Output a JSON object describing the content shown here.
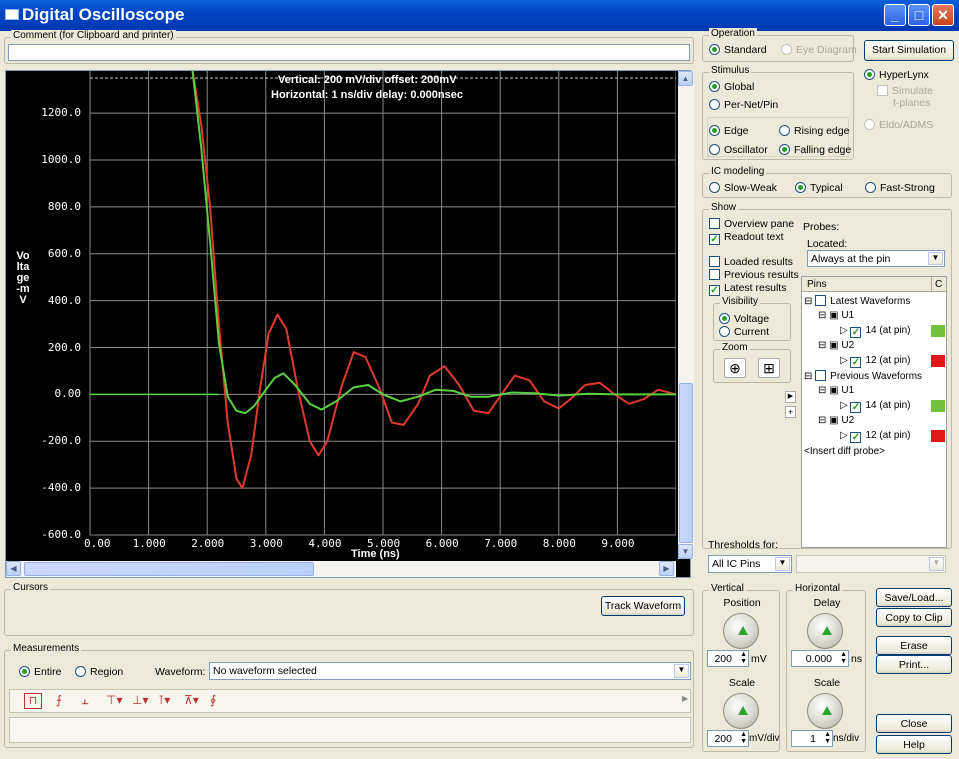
{
  "window": {
    "title": "Digital Oscilloscope"
  },
  "comment": {
    "label": "Comment (for Clipboard and printer)",
    "value": ""
  },
  "plot": {
    "header_vertical": "Vertical: 200 mV/div  offset: 200mV",
    "header_horizontal": "Horizontal: 1 ns/div  delay: 0.000nsec",
    "ylabel": "Voltage-mV",
    "xlabel": "Time  (ns)",
    "yticks": [
      "1200.0",
      "1000.0",
      "800.0",
      "600.0",
      "400.0",
      "200.0",
      "0.00",
      "-200.0",
      "-400.0",
      "-600.0"
    ],
    "xticks": [
      "0.00",
      "1.000",
      "2.000",
      "3.000",
      "4.000",
      "5.000",
      "6.000",
      "7.000",
      "8.000",
      "9.000"
    ]
  },
  "chart_data": {
    "type": "line",
    "xlabel": "Time  (ns)",
    "ylabel": "Voltage-mV",
    "xlim": [
      0,
      10
    ],
    "ylim": [
      -600,
      1380
    ],
    "grid": true,
    "series": [
      {
        "color": "#e03a2e",
        "x": [
          1.75,
          1.9,
          2.05,
          2.2,
          2.35,
          2.5,
          2.6,
          2.75,
          2.9,
          3.05,
          3.2,
          3.35,
          3.55,
          3.75,
          3.9,
          4.05,
          4.3,
          4.5,
          4.7,
          4.95,
          5.15,
          5.35,
          5.6,
          5.8,
          6.05,
          6.3,
          6.55,
          6.8,
          7.05,
          7.25,
          7.5,
          7.75,
          8.0,
          8.2,
          8.45,
          8.7,
          8.95,
          9.2,
          9.45,
          9.7,
          10.0
        ],
        "y": [
          1380,
          1150,
          800,
          300,
          -120,
          -360,
          -400,
          -260,
          20,
          260,
          340,
          280,
          20,
          -200,
          -260,
          -200,
          40,
          180,
          160,
          20,
          -120,
          -130,
          -40,
          80,
          120,
          40,
          -70,
          -80,
          10,
          80,
          60,
          -30,
          -60,
          -20,
          40,
          50,
          0,
          -40,
          -20,
          20,
          0
        ]
      },
      {
        "color": "#58d040",
        "x": [
          1.75,
          1.9,
          2.05,
          2.2,
          2.35,
          2.5,
          2.65,
          2.8,
          3.0,
          3.15,
          3.3,
          3.5,
          3.75,
          3.95,
          4.2,
          4.5,
          4.75,
          5.0,
          5.3,
          5.6,
          5.9,
          6.2,
          6.5,
          6.8,
          7.2,
          7.6,
          8.0,
          8.5,
          9.0,
          10.0
        ],
        "y": [
          1380,
          1050,
          650,
          220,
          -10,
          -70,
          -80,
          -50,
          20,
          70,
          90,
          40,
          -40,
          -65,
          -30,
          30,
          40,
          0,
          -30,
          -10,
          20,
          15,
          -10,
          -10,
          8,
          5,
          -5,
          3,
          0,
          0
        ]
      }
    ]
  },
  "operation": {
    "label": "Operation",
    "standard": "Standard",
    "eye": "Eye Diagram",
    "start": "Start Simulation"
  },
  "stimulus": {
    "label": "Stimulus",
    "global": "Global",
    "pernet": "Per-Net/Pin",
    "edge": "Edge",
    "oscillator": "Oscillator",
    "rising": "Rising edge",
    "falling": "Falling edge"
  },
  "engine": {
    "hyperlynx": "HyperLynx",
    "simulate": "Simulate",
    "tplanes": "t-planes",
    "eldo": "Eldo/ADMS"
  },
  "ic": {
    "label": "IC modeling",
    "slow": "Slow-Weak",
    "typical": "Typical",
    "fast": "Fast-Strong"
  },
  "show": {
    "label": "Show",
    "overview": "Overview pane",
    "readout": "Readout text",
    "loaded": "Loaded results",
    "previous": "Previous results",
    "latest": "Latest results",
    "visibility": "Visibility",
    "voltage": "Voltage",
    "current": "Current",
    "zoom": "Zoom"
  },
  "probes": {
    "label": "Probes:",
    "located": "Located:",
    "location_value": "Always at the pin",
    "col_pins": "Pins",
    "col_c": "C",
    "latest": "Latest Waveforms",
    "previous": "Previous Waveforms",
    "u1": "U1",
    "u2": "U2",
    "pin14": "14 (at pin)",
    "pin12": "12 (at pin)",
    "insert": "<Insert diff probe>",
    "green": "#72c23c",
    "red": "#e01818"
  },
  "thresholds": {
    "label": "Thresholds for:",
    "value": "All IC Pins"
  },
  "cursors": {
    "label": "Cursors",
    "track": "Track Waveform"
  },
  "measurements": {
    "label": "Measurements",
    "entire": "Entire",
    "region": "Region",
    "waveform_label": "Waveform:",
    "waveform_value": "No waveform selected"
  },
  "vertical": {
    "label": "Vertical",
    "position": "Position",
    "pos_value": "200",
    "pos_unit": "mV",
    "scale": "Scale",
    "scale_value": "200",
    "scale_unit": "mV/div"
  },
  "horizontal": {
    "label": "Horizontal",
    "delay": "Delay",
    "delay_value": "0.000",
    "delay_unit": "ns",
    "scale": "Scale",
    "scale_value": "1",
    "scale_unit": "ns/div"
  },
  "buttons": {
    "save": "Save/Load...",
    "copy": "Copy to Clip",
    "erase": "Erase",
    "print": "Print...",
    "close": "Close",
    "help": "Help"
  }
}
